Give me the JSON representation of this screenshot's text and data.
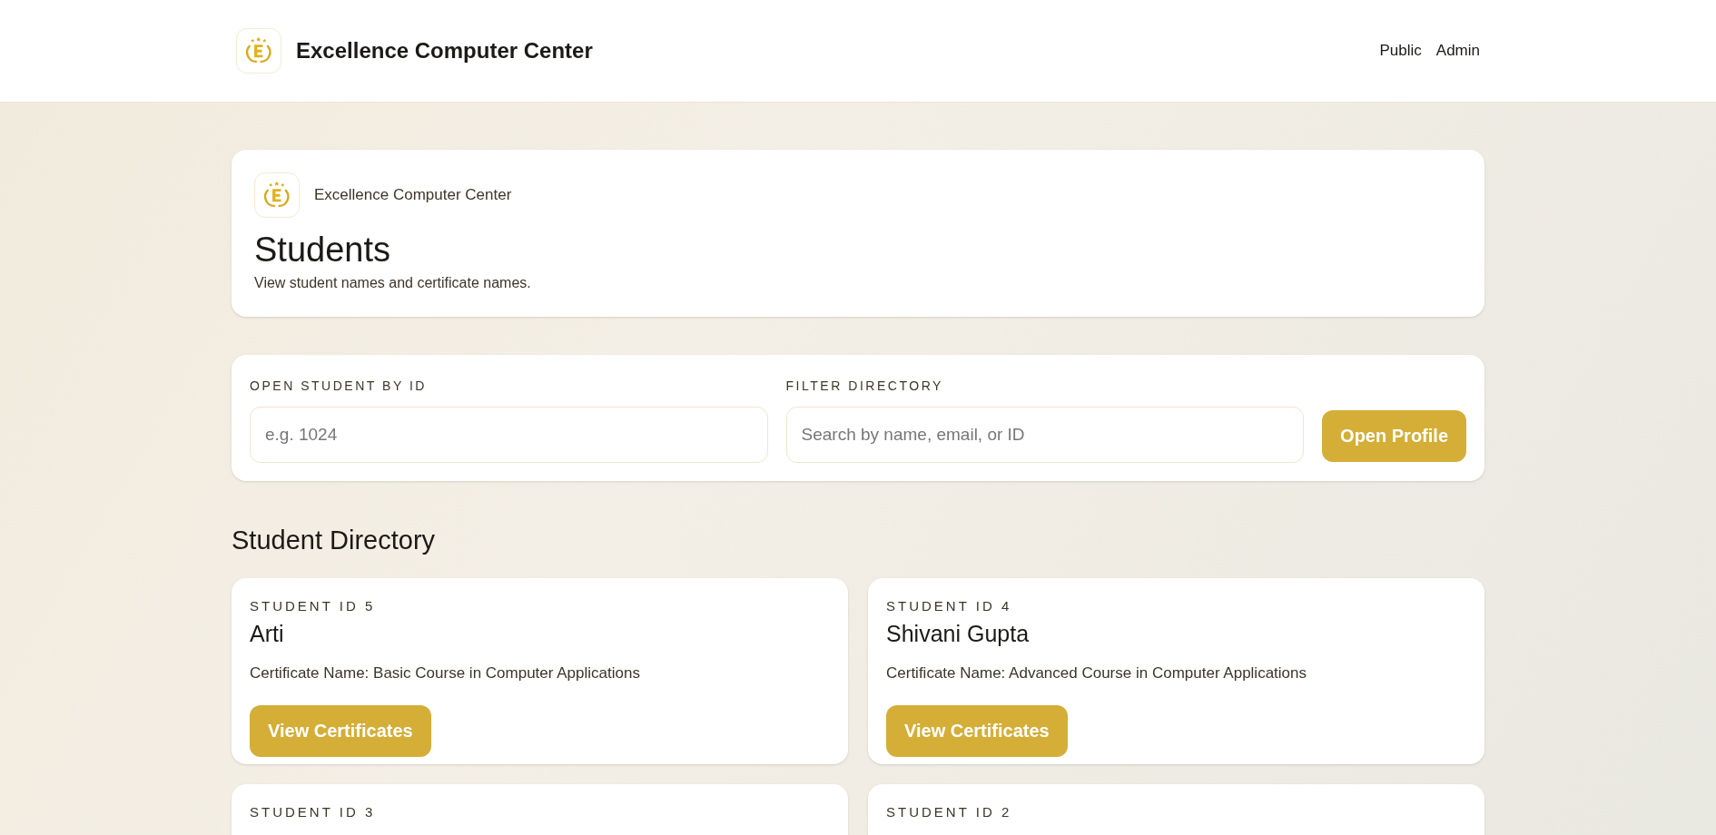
{
  "header": {
    "brand": "Excellence Computer Center",
    "nav": [
      {
        "label": "Public"
      },
      {
        "label": "Admin"
      }
    ]
  },
  "intro": {
    "brand": "Excellence Computer Center",
    "title": "Students",
    "subtitle": "View student names and certificate names."
  },
  "search": {
    "id_label": "OPEN STUDENT BY ID",
    "id_placeholder": "e.g. 1024",
    "filter_label": "FILTER DIRECTORY",
    "filter_placeholder": "Search by name, email, or ID",
    "button": "Open Profile"
  },
  "directory": {
    "title": "Student Directory",
    "students": [
      {
        "id_label": "STUDENT ID 5",
        "name": "Arti",
        "certificate": "Certificate Name: Basic Course in Computer Applications",
        "button": "View Certificates"
      },
      {
        "id_label": "STUDENT ID 4",
        "name": "Shivani Gupta",
        "certificate": "Certificate Name: Advanced Course in Computer Applications",
        "button": "View Certificates"
      },
      {
        "id_label": "STUDENT ID 3"
      },
      {
        "id_label": "STUDENT ID 2"
      }
    ]
  }
}
